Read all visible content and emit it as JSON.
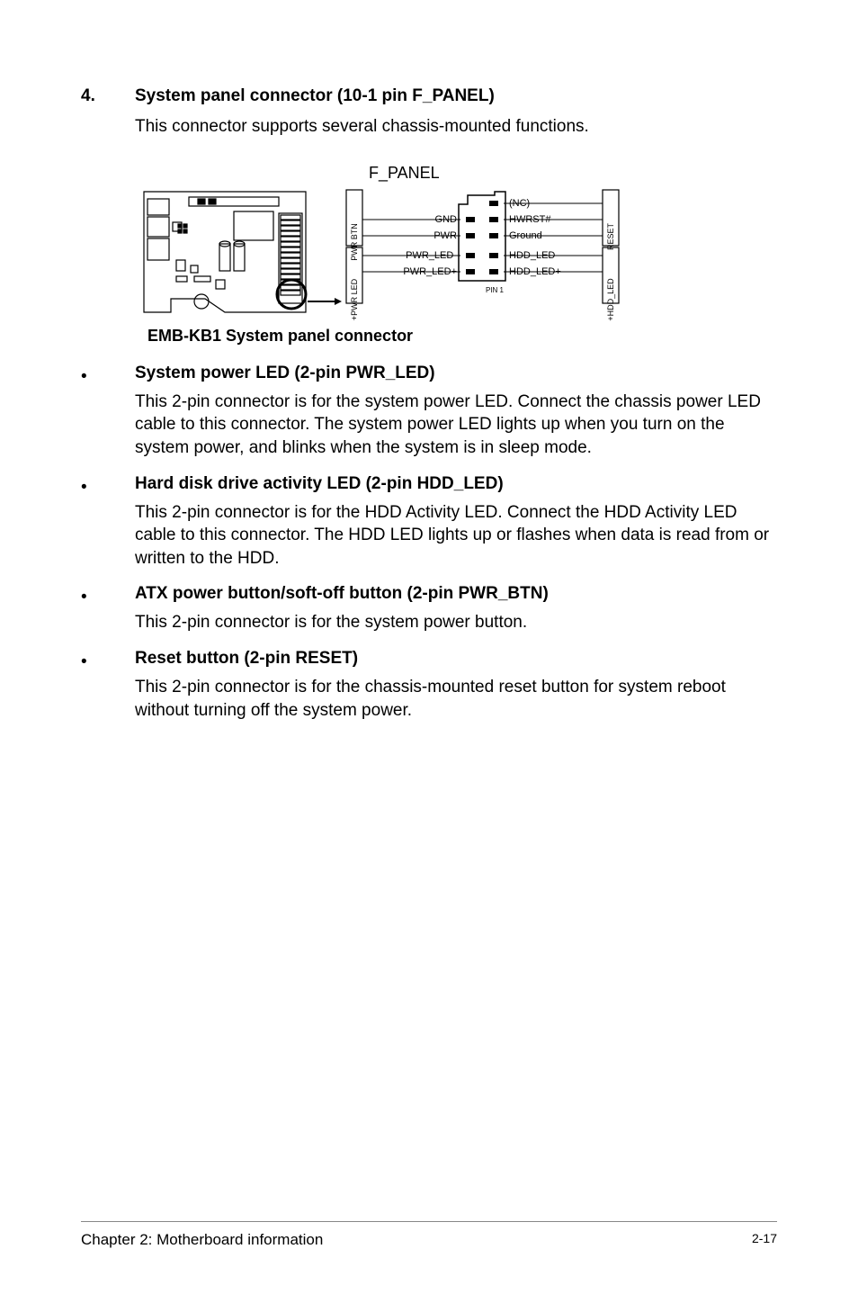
{
  "section": {
    "number": "4.",
    "title": "System panel connector (10-1 pin F_PANEL)",
    "body": "This connector supports several chassis-mounted functions."
  },
  "diagram": {
    "title": "F_PANEL",
    "caption": "EMB-KB1 System panel connector",
    "labels": {
      "pwr_btn": "PWR BTN",
      "pwr_led_box": "+PWR LED",
      "reset_box": "RESET",
      "hdd_led_box": "+HDD_LED",
      "gnd": "GND",
      "pwr": "PWR",
      "pwr_led_minus": "PWR_LED-",
      "pwr_led_plus": "PWR_LED+",
      "nc": "(NC)",
      "hwrst": "HWRST#",
      "ground": "Ground",
      "hdd_led_minus": "HDD_LED-",
      "hdd_led_plus": "HDD_LED+",
      "pin1": "PIN 1"
    }
  },
  "bullets": [
    {
      "title": "System power LED (2-pin PWR_LED)",
      "body": "This 2-pin connector is for the system power LED. Connect the chassis power LED cable to this connector. The system power LED lights up when you turn on the system power, and blinks when the system is in sleep mode."
    },
    {
      "title": "Hard disk drive activity LED (2-pin HDD_LED)",
      "body": "This 2-pin connector is for the HDD Activity LED. Connect the HDD Activity LED cable to this connector. The HDD LED lights up or flashes when data is read from or written to the HDD."
    },
    {
      "title": "ATX power button/soft-off button (2-pin PWR_BTN)",
      "body": "This 2-pin connector is for the system power button."
    },
    {
      "title": "Reset button (2-pin RESET)",
      "body": "This 2-pin connector is for the chassis-mounted reset button for system reboot without turning off the system power."
    }
  ],
  "footer": {
    "left": "Chapter 2: Motherboard information",
    "right": "2-17"
  }
}
